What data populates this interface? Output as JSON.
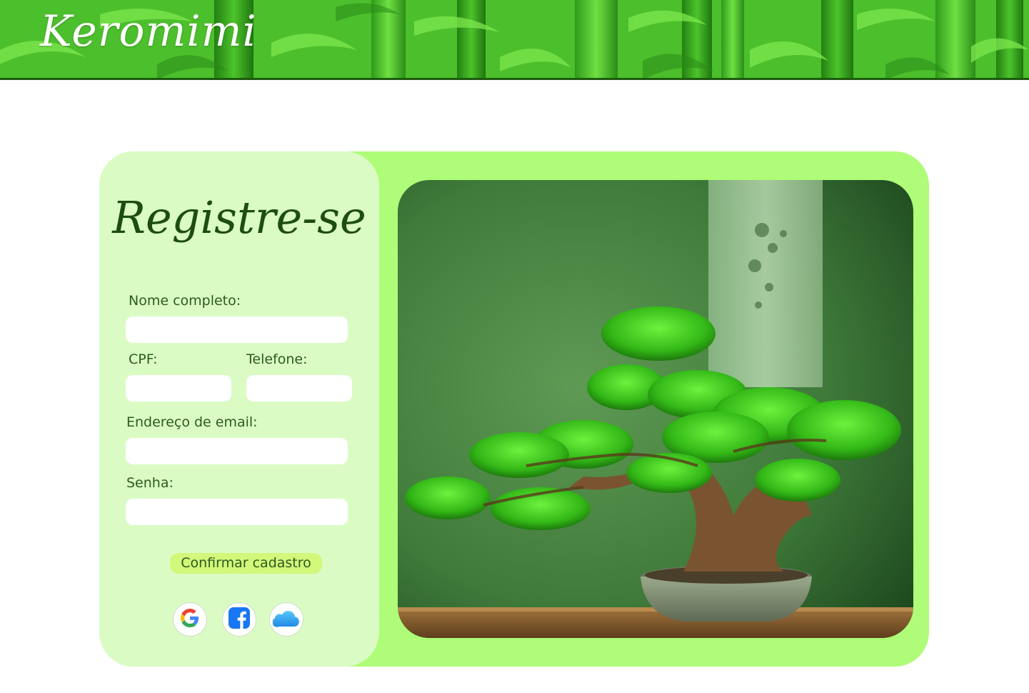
{
  "header": {
    "brand": "Keromimi"
  },
  "register": {
    "title": "Registre-se",
    "fields": {
      "full_name": {
        "label": "Nome completo:",
        "value": ""
      },
      "cpf": {
        "label": "CPF:",
        "value": ""
      },
      "phone": {
        "label": "Telefone:",
        "value": ""
      },
      "email": {
        "label": "Endereço de email:",
        "value": ""
      },
      "password": {
        "label": "Senha:",
        "value": ""
      }
    },
    "confirm_label": "Confirmar cadastro",
    "social_logins": [
      {
        "icon": "google-icon"
      },
      {
        "icon": "facebook-icon"
      },
      {
        "icon": "icloud-icon"
      }
    ]
  },
  "colors": {
    "card_background": "#aefc78",
    "form_panel_background": "#dafcc4",
    "title_color": "#1d4d10",
    "text_color": "#2d5a1e",
    "button_background": "#d2f77a",
    "header_border": "#1f5a10"
  }
}
